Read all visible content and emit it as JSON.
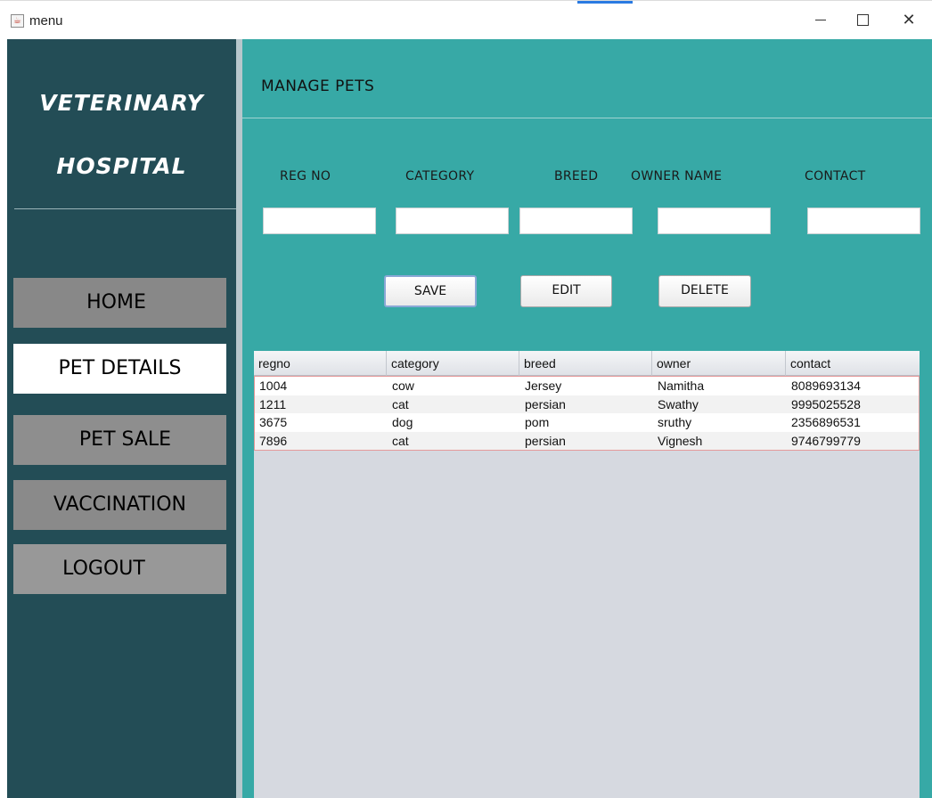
{
  "window": {
    "title": "menu",
    "app_icon": "java-coffee-icon",
    "minimize_icon": "minimize-icon",
    "maximize_icon": "maximize-icon",
    "close_icon": "close-icon"
  },
  "sidebar": {
    "brand_line1": "VETERINARY",
    "brand_line2": "HOSPITAL",
    "items": [
      {
        "label": "HOME",
        "selected": false
      },
      {
        "label": "PET DETAILS",
        "selected": true
      },
      {
        "label": "PET SALE",
        "selected": false
      },
      {
        "label": "VACCINATION",
        "selected": false
      },
      {
        "label": "LOGOUT",
        "selected": false
      }
    ]
  },
  "main": {
    "title": "MANAGE PETS",
    "fields": {
      "regno": {
        "label": "REG NO",
        "value": ""
      },
      "category": {
        "label": "CATEGORY",
        "value": ""
      },
      "breed": {
        "label": "BREED",
        "value": ""
      },
      "owner": {
        "label": "OWNER NAME",
        "value": ""
      },
      "contact": {
        "label": "CONTACT",
        "value": ""
      }
    },
    "buttons": {
      "save": "SAVE",
      "edit": "EDIT",
      "delete": "DELETE"
    }
  },
  "table": {
    "columns": [
      "regno",
      "category",
      "breed",
      "owner",
      "contact"
    ],
    "rows": [
      [
        "1004",
        "cow",
        "Jersey",
        "Namitha",
        "8089693134"
      ],
      [
        "1211",
        "cat",
        "persian",
        "Swathy",
        "9995025528"
      ],
      [
        "3675",
        "dog",
        "pom",
        "sruthy",
        "2356896531"
      ],
      [
        "7896",
        "cat",
        "persian",
        "Vignesh",
        "9746799779"
      ]
    ]
  },
  "colors": {
    "sidebar_bg": "#234d56",
    "main_bg": "#37a9a6",
    "nav_button": "#8c8c8c",
    "nav_selected": "#ffffff",
    "table_bg": "#d6d9e0",
    "selection_border": "#e59a9a"
  }
}
